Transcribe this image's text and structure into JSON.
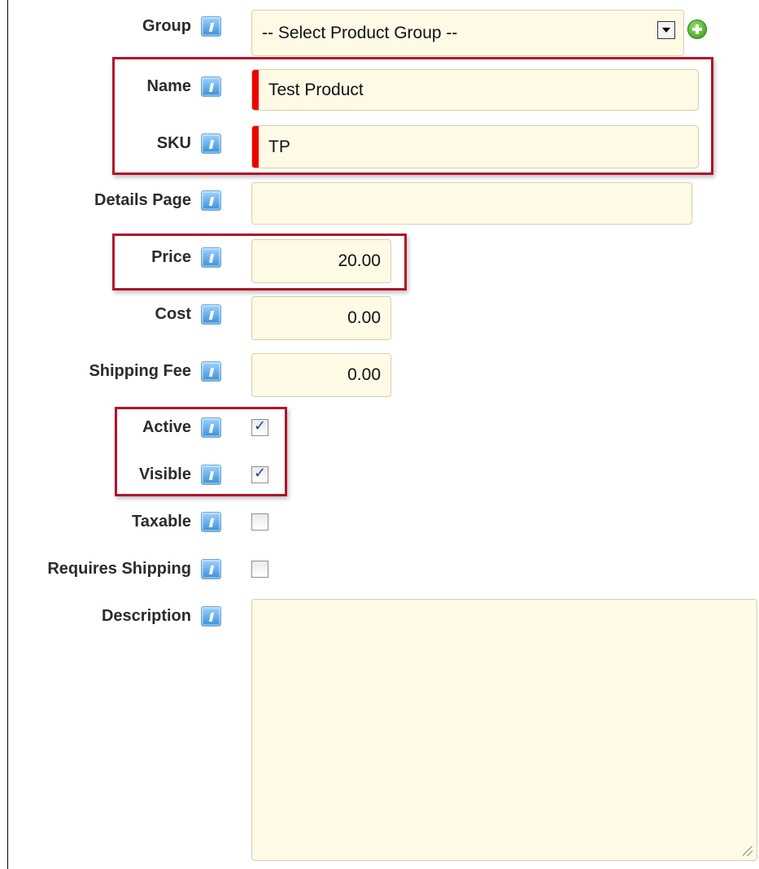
{
  "form": {
    "group": {
      "label": "Group",
      "value": "-- Select Product Group --"
    },
    "name": {
      "label": "Name",
      "value": "Test Product"
    },
    "sku": {
      "label": "SKU",
      "value": "TP"
    },
    "details_page": {
      "label": "Details Page",
      "value": ""
    },
    "price": {
      "label": "Price",
      "value": "20.00"
    },
    "cost": {
      "label": "Cost",
      "value": "0.00"
    },
    "shipping_fee": {
      "label": "Shipping Fee",
      "value": "0.00"
    },
    "active": {
      "label": "Active",
      "checked": true
    },
    "visible": {
      "label": "Visible",
      "checked": true
    },
    "taxable": {
      "label": "Taxable",
      "checked": false
    },
    "requires_shipping": {
      "label": "Requires Shipping",
      "checked": false
    },
    "description": {
      "label": "Description",
      "value": ""
    }
  },
  "colors": {
    "field_background": "#fffae6",
    "required_marker": "#ee0000",
    "highlight_border": "#b0152a",
    "help_icon": "#3a8fd6",
    "add_icon": "#2f9a16"
  },
  "icons": {
    "help": "help-icon",
    "add": "add-circle-icon",
    "dropdown": "chevron-down-icon",
    "resize": "resize-grip-icon"
  }
}
